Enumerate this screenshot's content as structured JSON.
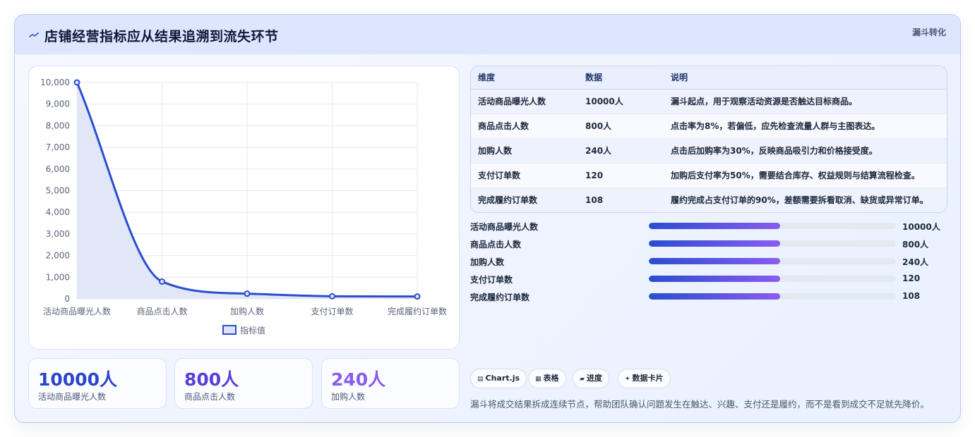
{
  "header": {
    "title": "店铺经营指标应从结果追溯到流失环节",
    "tag": "漏斗转化",
    "icon": "wave-icon"
  },
  "chart_data": {
    "type": "line",
    "categories": [
      "活动商品曝光人数",
      "商品点击人数",
      "加购人数",
      "支付订单数",
      "完成履约订单数"
    ],
    "series": [
      {
        "name": "指标值",
        "values": [
          10000,
          800,
          240,
          120,
          108
        ]
      }
    ],
    "ylim": [
      0,
      10000
    ],
    "yticks": [
      "0",
      "1,000",
      "2,000",
      "3,000",
      "4,000",
      "5,000",
      "6,000",
      "7,000",
      "8,000",
      "9,000",
      "10,000"
    ],
    "fill": true,
    "smooth": true,
    "grid": true,
    "legend": "bottom",
    "colors": {
      "line": "#2a4ecf",
      "area": "#dde3f7"
    }
  },
  "kpis": [
    {
      "value": "10000人",
      "label": "活动商品曝光人数",
      "color": "#2a46c8"
    },
    {
      "value": "800人",
      "label": "商品点击人数",
      "color": "#5a3fd6"
    },
    {
      "value": "240人",
      "label": "加购人数",
      "color": "#8a5cf0"
    }
  ],
  "table": {
    "headers": [
      "维度",
      "数据",
      "说明"
    ],
    "rows": [
      [
        "活动商品曝光人数",
        "10000人",
        "漏斗起点，用于观察活动资源是否触达目标商品。"
      ],
      [
        "商品点击人数",
        "800人",
        "点击率为8%，若偏低，应先检查流量人群与主图表达。"
      ],
      [
        "加购人数",
        "240人",
        "点击后加购率为30%，反映商品吸引力和价格接受度。"
      ],
      [
        "支付订单数",
        "120",
        "加购后支付率为50%，需要结合库存、权益规则与结算流程检查。"
      ],
      [
        "完成履约订单数",
        "108",
        "履约完成占支付订单的90%，差额需要拆看取消、缺货或异常订单。"
      ]
    ]
  },
  "progress": [
    {
      "label": "活动商品曝光人数",
      "value": "10000人",
      "fraction": 0.53
    },
    {
      "label": "商品点击人数",
      "value": "800人",
      "fraction": 0.53
    },
    {
      "label": "加购人数",
      "value": "240人",
      "fraction": 0.53
    },
    {
      "label": "支付订单数",
      "value": "120",
      "fraction": 0.53
    },
    {
      "label": "完成履约订单数",
      "value": "108",
      "fraction": 0.53
    }
  ],
  "chips": [
    {
      "icon": "▤",
      "label": "Chart.js"
    },
    {
      "icon": "▦",
      "label": "表格"
    },
    {
      "icon": "▰",
      "label": "进度"
    },
    {
      "icon": "✦",
      "label": "数据卡片"
    }
  ],
  "footnote": "漏斗将成交结果拆成连续节点，帮助团队确认问题发生在触达、兴趣、支付还是履约，而不是看到成交不足就先降价。"
}
